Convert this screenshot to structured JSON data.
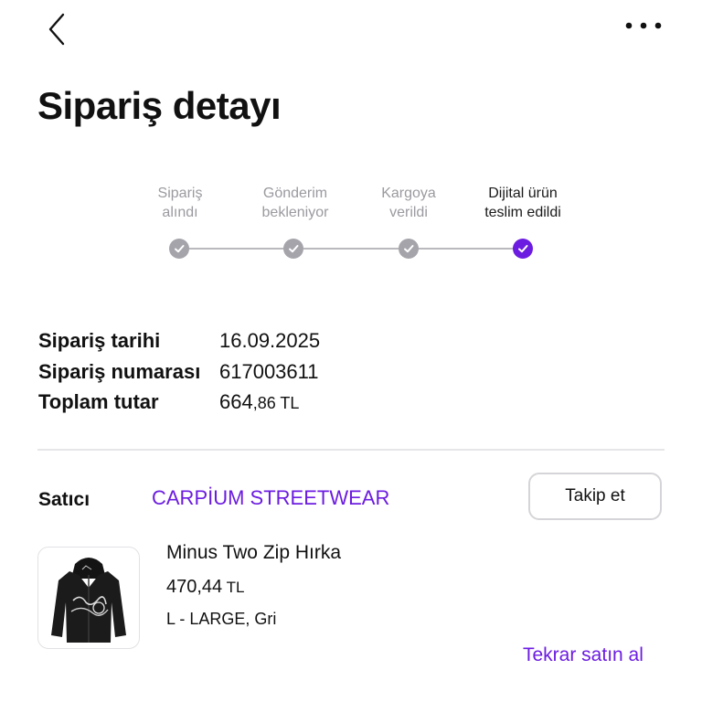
{
  "header": {
    "back_icon": "chevron-left-icon",
    "more_icon": "more-horizontal-icon"
  },
  "title": "Sipariş detayı",
  "stepper": {
    "steps": [
      {
        "line1": "Sipariş",
        "line2": "alındı",
        "status": "done"
      },
      {
        "line1": "Gönderim",
        "line2": "bekleniyor",
        "status": "done"
      },
      {
        "line1": "Kargoya",
        "line2": "verildi",
        "status": "done"
      },
      {
        "line1": "Dijital ürün",
        "line2": "teslim edildi",
        "status": "current"
      }
    ],
    "check_icon": "check-icon",
    "colors": {
      "done": "#a4a4aa",
      "current": "#6c1ce0"
    }
  },
  "order_info": {
    "date_label": "Sipariş tarihi",
    "date_value": "16.09.2025",
    "number_label": "Sipariş numarası",
    "number_value": "617003611",
    "total_label": "Toplam tutar",
    "total_main": "664",
    "total_rest": ",86 TL"
  },
  "seller": {
    "label": "Satıcı",
    "name": "CARPİUM STREETWEAR",
    "follow_label": "Takip et"
  },
  "product": {
    "name": "Minus Two Zip Hırka",
    "price_main": "470,44",
    "price_currency": " TL",
    "variant": "L - LARGE, Gri",
    "image_icon": "black-zip-hoodie-image",
    "rebuy_label": "Tekrar satın al"
  },
  "colors": {
    "accent": "#6c1ce0",
    "text": "#111111",
    "muted": "#9a9aa0"
  }
}
